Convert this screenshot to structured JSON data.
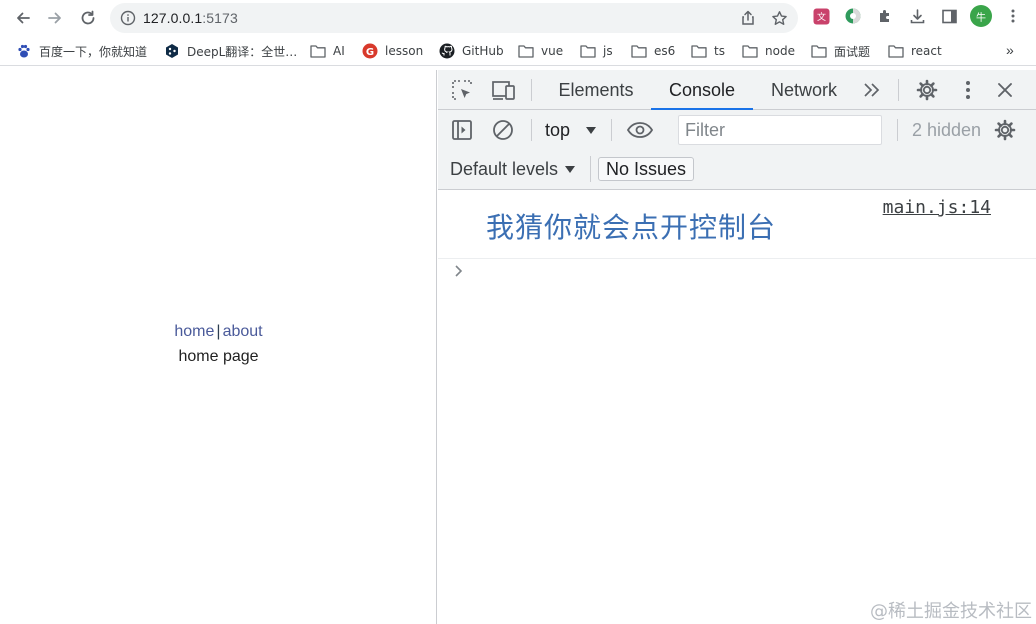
{
  "browser": {
    "url_host": "127.0.0.1",
    "url_port": ":5173",
    "avatar_letter": "牛"
  },
  "bookmarks": [
    {
      "label": "百度一下，你就知道",
      "icon": "baidu-paw-icon"
    },
    {
      "label": "DeepL翻译：全世…",
      "icon": "deepl-icon"
    },
    {
      "label": "AI",
      "icon": "folder-icon"
    },
    {
      "label": "lesson",
      "icon": "g-logo-icon"
    },
    {
      "label": "GitHub",
      "icon": "github-icon"
    },
    {
      "label": "vue",
      "icon": "folder-icon"
    },
    {
      "label": "js",
      "icon": "folder-icon"
    },
    {
      "label": "es6",
      "icon": "folder-icon"
    },
    {
      "label": "ts",
      "icon": "folder-icon"
    },
    {
      "label": "node",
      "icon": "folder-icon"
    },
    {
      "label": "面试题",
      "icon": "folder-icon"
    },
    {
      "label": "react",
      "icon": "folder-icon"
    }
  ],
  "bookmarks_more": "»",
  "page": {
    "nav_home": "home",
    "nav_separator": "|",
    "nav_about": "about",
    "body_text": "home page"
  },
  "devtools": {
    "tabs": [
      "Elements",
      "Console",
      "Network"
    ],
    "active_tab": "Console",
    "more_tabs": "»",
    "context": "top",
    "filter_placeholder": "Filter",
    "hidden_count": "2 hidden",
    "levels_label": "Default levels",
    "issues_label": "No Issues",
    "console_message": "我猜你就会点开控制台",
    "console_source": "main.js:14"
  },
  "watermark": "@稀土掘金技术社区",
  "colors": {
    "accent": "#1a73e8",
    "link": "#4a5a9a",
    "console_text": "#3b6fb3"
  }
}
